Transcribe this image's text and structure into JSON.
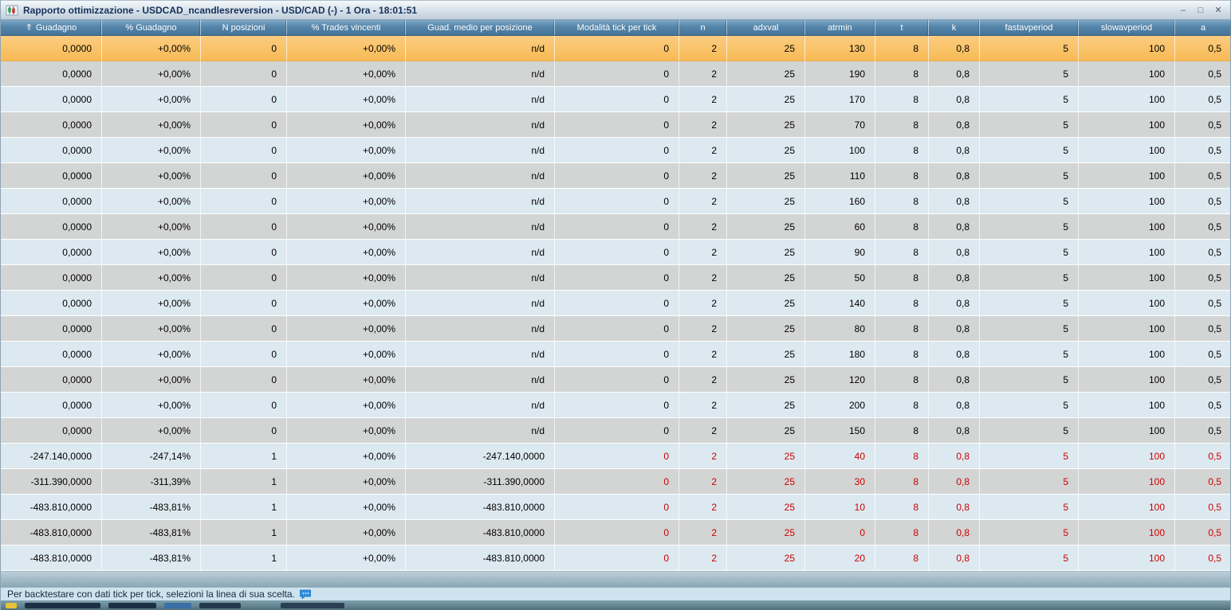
{
  "window": {
    "title": "Rapporto ottimizzazione - USDCAD_ncandlesreversion - USD/CAD (-) - 1 Ora - 18:01:51",
    "minimize_label": "–",
    "maximize_label": "□",
    "close_label": "✕"
  },
  "table": {
    "sort_indicator": "⇑",
    "columns": [
      {
        "label": "Guadagno",
        "sorted": true
      },
      {
        "label": "% Guadagno"
      },
      {
        "label": "N posizioni"
      },
      {
        "label": "% Trades vincenti"
      },
      {
        "label": "Guad. medio per posizione"
      },
      {
        "label": "Modalità tick per tick"
      },
      {
        "label": "n"
      },
      {
        "label": "adxval"
      },
      {
        "label": "atrmin"
      },
      {
        "label": "t"
      },
      {
        "label": "k"
      },
      {
        "label": "fastavperiod"
      },
      {
        "label": "slowavperiod"
      },
      {
        "label": "a"
      }
    ],
    "rows": [
      {
        "selected": true,
        "params_red": false,
        "cells": [
          "0,0000",
          "+0,00%",
          "0",
          "+0,00%",
          "n/d",
          "0",
          "2",
          "25",
          "130",
          "8",
          "0,8",
          "5",
          "100",
          "0,5"
        ]
      },
      {
        "selected": false,
        "params_red": false,
        "cells": [
          "0,0000",
          "+0,00%",
          "0",
          "+0,00%",
          "n/d",
          "0",
          "2",
          "25",
          "190",
          "8",
          "0,8",
          "5",
          "100",
          "0,5"
        ]
      },
      {
        "selected": false,
        "params_red": false,
        "cells": [
          "0,0000",
          "+0,00%",
          "0",
          "+0,00%",
          "n/d",
          "0",
          "2",
          "25",
          "170",
          "8",
          "0,8",
          "5",
          "100",
          "0,5"
        ]
      },
      {
        "selected": false,
        "params_red": false,
        "cells": [
          "0,0000",
          "+0,00%",
          "0",
          "+0,00%",
          "n/d",
          "0",
          "2",
          "25",
          "70",
          "8",
          "0,8",
          "5",
          "100",
          "0,5"
        ]
      },
      {
        "selected": false,
        "params_red": false,
        "cells": [
          "0,0000",
          "+0,00%",
          "0",
          "+0,00%",
          "n/d",
          "0",
          "2",
          "25",
          "100",
          "8",
          "0,8",
          "5",
          "100",
          "0,5"
        ]
      },
      {
        "selected": false,
        "params_red": false,
        "cells": [
          "0,0000",
          "+0,00%",
          "0",
          "+0,00%",
          "n/d",
          "0",
          "2",
          "25",
          "110",
          "8",
          "0,8",
          "5",
          "100",
          "0,5"
        ]
      },
      {
        "selected": false,
        "params_red": false,
        "cells": [
          "0,0000",
          "+0,00%",
          "0",
          "+0,00%",
          "n/d",
          "0",
          "2",
          "25",
          "160",
          "8",
          "0,8",
          "5",
          "100",
          "0,5"
        ]
      },
      {
        "selected": false,
        "params_red": false,
        "cells": [
          "0,0000",
          "+0,00%",
          "0",
          "+0,00%",
          "n/d",
          "0",
          "2",
          "25",
          "60",
          "8",
          "0,8",
          "5",
          "100",
          "0,5"
        ]
      },
      {
        "selected": false,
        "params_red": false,
        "cells": [
          "0,0000",
          "+0,00%",
          "0",
          "+0,00%",
          "n/d",
          "0",
          "2",
          "25",
          "90",
          "8",
          "0,8",
          "5",
          "100",
          "0,5"
        ]
      },
      {
        "selected": false,
        "params_red": false,
        "cells": [
          "0,0000",
          "+0,00%",
          "0",
          "+0,00%",
          "n/d",
          "0",
          "2",
          "25",
          "50",
          "8",
          "0,8",
          "5",
          "100",
          "0,5"
        ]
      },
      {
        "selected": false,
        "params_red": false,
        "cells": [
          "0,0000",
          "+0,00%",
          "0",
          "+0,00%",
          "n/d",
          "0",
          "2",
          "25",
          "140",
          "8",
          "0,8",
          "5",
          "100",
          "0,5"
        ]
      },
      {
        "selected": false,
        "params_red": false,
        "cells": [
          "0,0000",
          "+0,00%",
          "0",
          "+0,00%",
          "n/d",
          "0",
          "2",
          "25",
          "80",
          "8",
          "0,8",
          "5",
          "100",
          "0,5"
        ]
      },
      {
        "selected": false,
        "params_red": false,
        "cells": [
          "0,0000",
          "+0,00%",
          "0",
          "+0,00%",
          "n/d",
          "0",
          "2",
          "25",
          "180",
          "8",
          "0,8",
          "5",
          "100",
          "0,5"
        ]
      },
      {
        "selected": false,
        "params_red": false,
        "cells": [
          "0,0000",
          "+0,00%",
          "0",
          "+0,00%",
          "n/d",
          "0",
          "2",
          "25",
          "120",
          "8",
          "0,8",
          "5",
          "100",
          "0,5"
        ]
      },
      {
        "selected": false,
        "params_red": false,
        "cells": [
          "0,0000",
          "+0,00%",
          "0",
          "+0,00%",
          "n/d",
          "0",
          "2",
          "25",
          "200",
          "8",
          "0,8",
          "5",
          "100",
          "0,5"
        ]
      },
      {
        "selected": false,
        "params_red": false,
        "cells": [
          "0,0000",
          "+0,00%",
          "0",
          "+0,00%",
          "n/d",
          "0",
          "2",
          "25",
          "150",
          "8",
          "0,8",
          "5",
          "100",
          "0,5"
        ]
      },
      {
        "selected": false,
        "params_red": true,
        "cells": [
          "-247.140,0000",
          "-247,14%",
          "1",
          "+0,00%",
          "-247.140,0000",
          "0",
          "2",
          "25",
          "40",
          "8",
          "0,8",
          "5",
          "100",
          "0,5"
        ]
      },
      {
        "selected": false,
        "params_red": true,
        "cells": [
          "-311.390,0000",
          "-311,39%",
          "1",
          "+0,00%",
          "-311.390,0000",
          "0",
          "2",
          "25",
          "30",
          "8",
          "0,8",
          "5",
          "100",
          "0,5"
        ]
      },
      {
        "selected": false,
        "params_red": true,
        "cells": [
          "-483.810,0000",
          "-483,81%",
          "1",
          "+0,00%",
          "-483.810,0000",
          "0",
          "2",
          "25",
          "10",
          "8",
          "0,8",
          "5",
          "100",
          "0,5"
        ]
      },
      {
        "selected": false,
        "params_red": true,
        "cells": [
          "-483.810,0000",
          "-483,81%",
          "1",
          "+0,00%",
          "-483.810,0000",
          "0",
          "2",
          "25",
          "0",
          "8",
          "0,8",
          "5",
          "100",
          "0,5"
        ]
      },
      {
        "selected": false,
        "params_red": true,
        "cells": [
          "-483.810,0000",
          "-483,81%",
          "1",
          "+0,00%",
          "-483.810,0000",
          "0",
          "2",
          "25",
          "20",
          "8",
          "0,8",
          "5",
          "100",
          "0,5"
        ]
      }
    ]
  },
  "status_bar": {
    "message": "Per backtestare con dati tick per tick, selezioni la linea di sua scelta."
  },
  "colors": {
    "header_bg": "#44749a",
    "selected_row": "#f7ba55",
    "row_blue": "#dde9f0",
    "row_gray": "#d3d4d4",
    "negative_param_text": "#cc0000",
    "status_bg": "#cde3ee"
  }
}
